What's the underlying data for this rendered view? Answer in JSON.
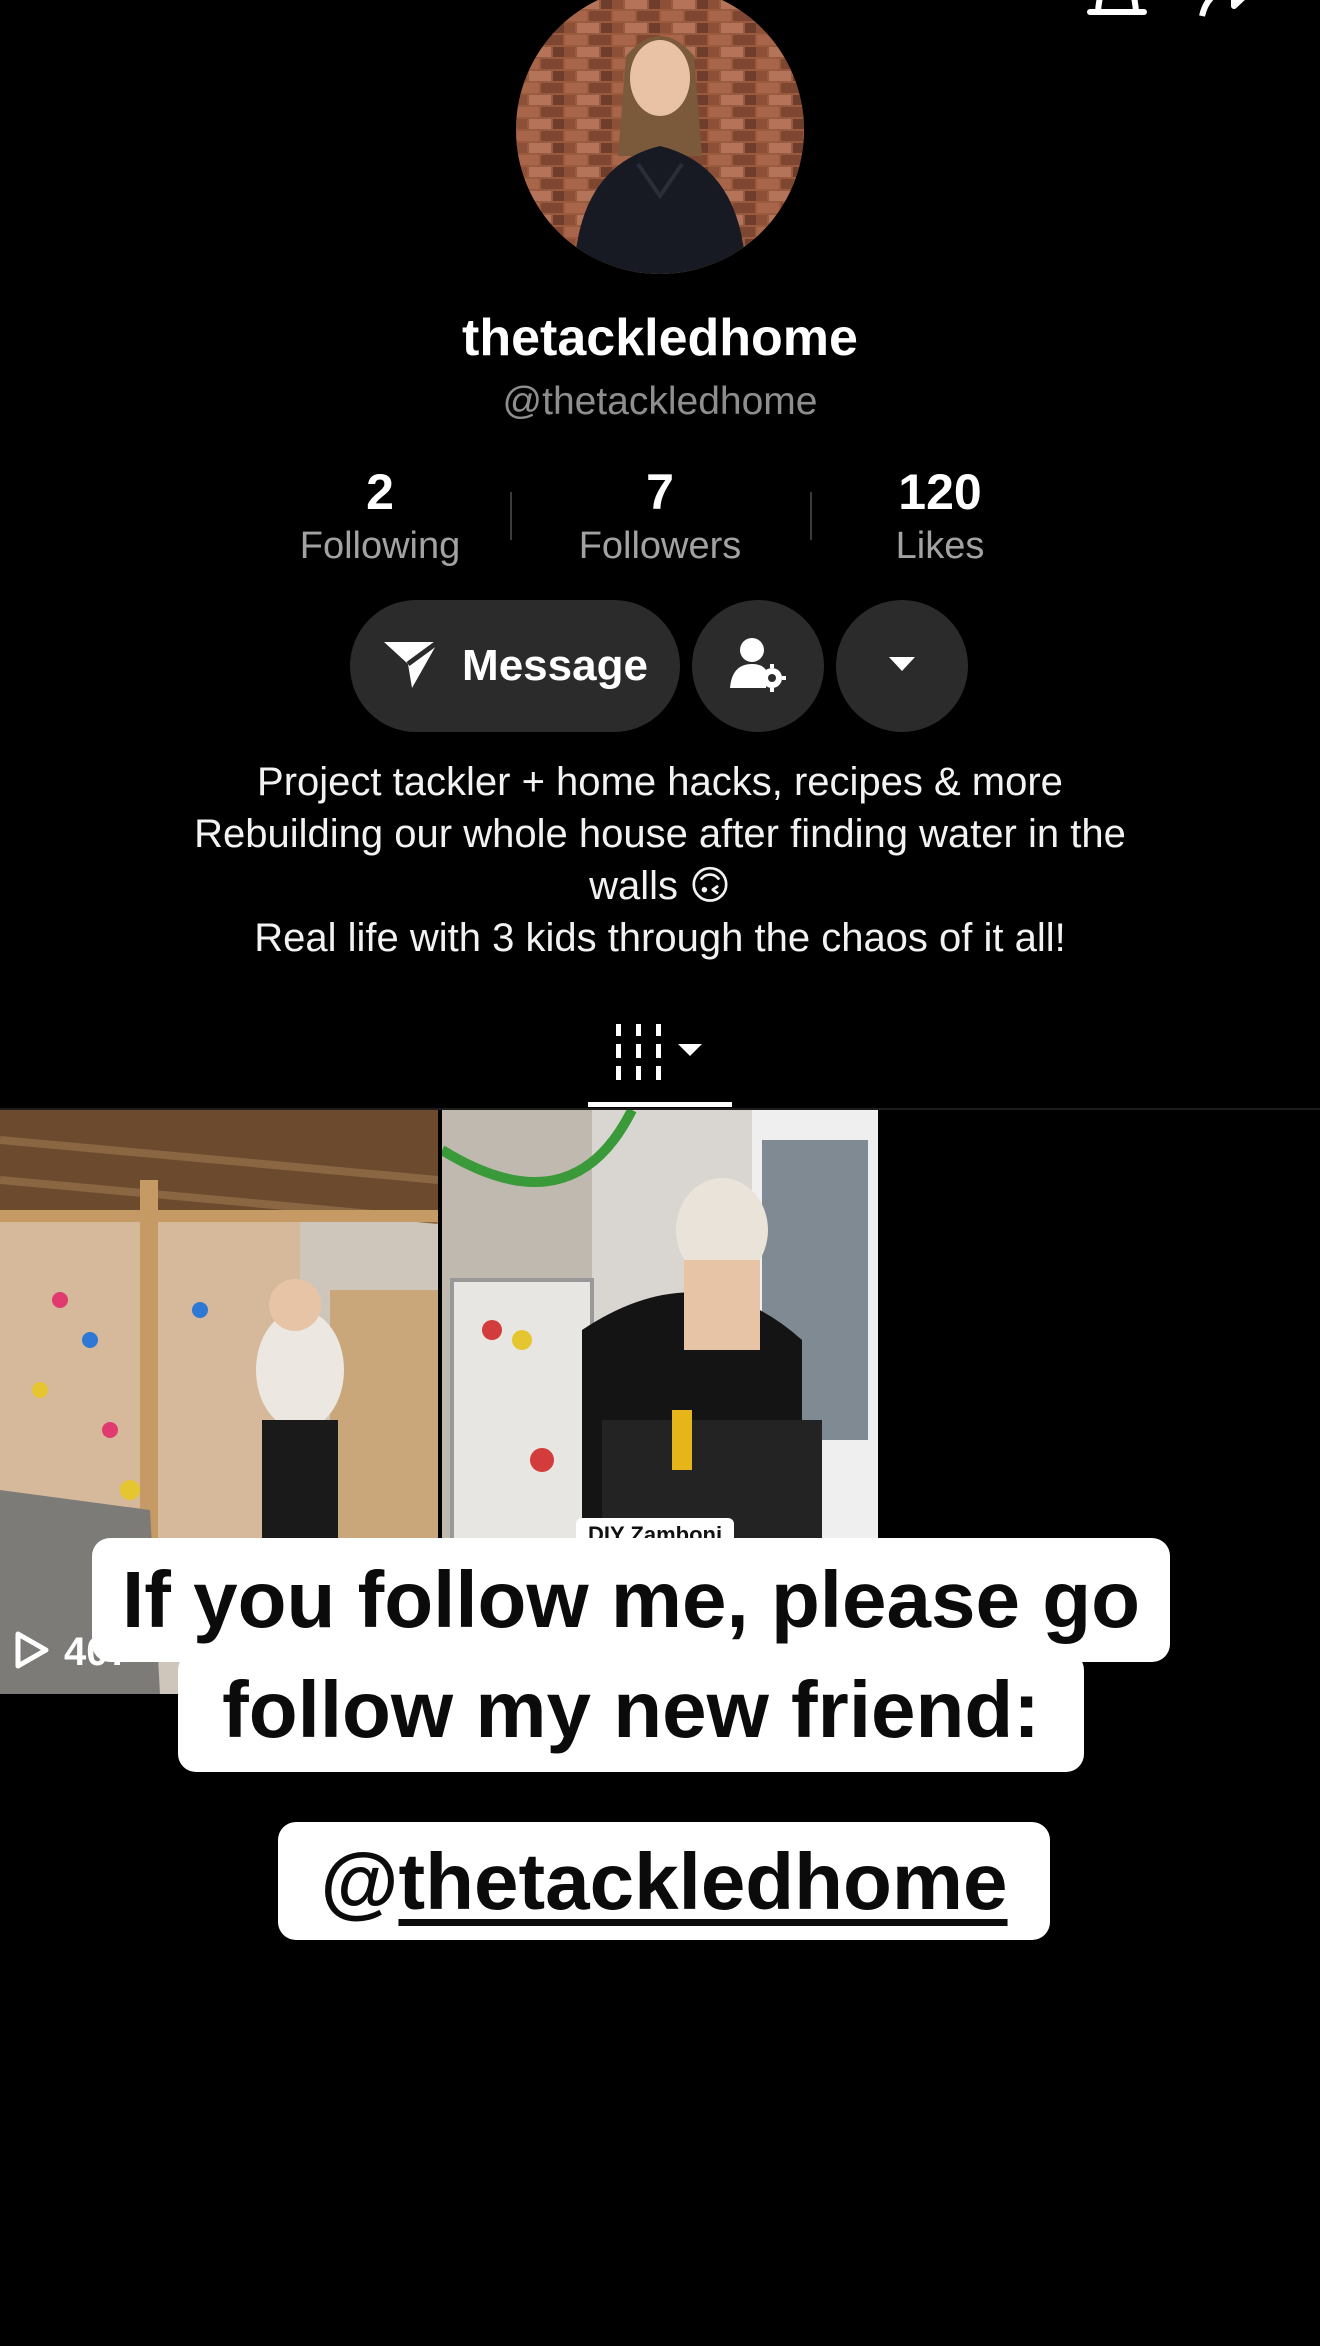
{
  "profile": {
    "display_name": "thetackledhome",
    "handle": "@thetackledhome"
  },
  "stats": [
    {
      "value": "2",
      "label": "Following"
    },
    {
      "value": "7",
      "label": "Followers"
    },
    {
      "value": "120",
      "label": "Likes"
    }
  ],
  "actions": {
    "message_label": "Message"
  },
  "bio": {
    "line1": "Project tackler + home hacks, recipes & more",
    "line2": "Rebuilding our whole house after finding water in the",
    "line3": "walls 🙃",
    "line4": "Real life with 3 kids through the chaos of it all!"
  },
  "videos": [
    {
      "play_count": "407"
    },
    {
      "overlay_text": "DIY Zamboni"
    }
  ],
  "caption": {
    "line1": "If you follow me, please go",
    "line2": "follow my new friend:",
    "mention_at": "@",
    "mention_name": "thetackledhome"
  },
  "icons": {
    "back": "back-arrow-icon",
    "bell": "bell-icon",
    "share": "share-icon",
    "send": "send-icon",
    "follow_settings": "person-gear-icon",
    "more": "caret-down-icon",
    "grid": "videos-grid-icon",
    "play": "play-icon"
  }
}
